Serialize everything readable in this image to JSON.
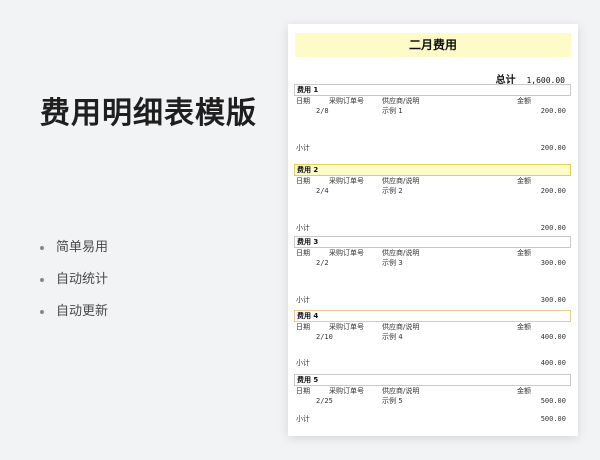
{
  "hero": {
    "title": "费用明细表模版",
    "bullets": [
      "简单易用",
      "自动统计",
      "自动更新"
    ]
  },
  "sheet": {
    "title": "二月费用",
    "total_label": "总计",
    "total_value": "1,600.00",
    "columns": {
      "date": "日期",
      "po": "采购订单号",
      "supplier": "供应商/说明",
      "amount": "金额"
    },
    "subtotal_label": "小计",
    "sections": [
      {
        "name": "费用 1",
        "date": "2/8",
        "supplier": "示例 1",
        "amount": "200.00",
        "subtotal": "200.00"
      },
      {
        "name": "费用 2",
        "date": "2/4",
        "supplier": "示例 2",
        "amount": "200.00",
        "subtotal": "200.00"
      },
      {
        "name": "费用 3",
        "date": "2/2",
        "supplier": "示例 3",
        "amount": "300.00",
        "subtotal": "300.00"
      },
      {
        "name": "费用 4",
        "date": "2/10",
        "supplier": "示例 4",
        "amount": "400.00",
        "subtotal": "400.00"
      },
      {
        "name": "费用 5",
        "date": "2/25",
        "supplier": "示例 5",
        "amount": "500.00",
        "subtotal": "500.00"
      }
    ]
  },
  "colors": {
    "title_fill": "#fffbc9",
    "highlight_border": "#e2cf55"
  }
}
